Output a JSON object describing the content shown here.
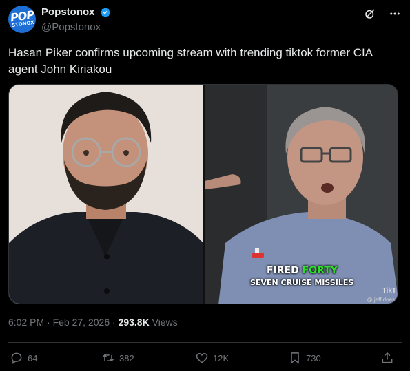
{
  "author": {
    "display_name": "Popstonox",
    "handle": "@Popstonox",
    "avatar_text_top": "POP",
    "avatar_text_bottom": "STONOX",
    "verified_color": "#1d9bf0"
  },
  "tweet": {
    "text": "Hasan Piker confirms upcoming stream with trending tiktok former CIA agent John Kiriakou"
  },
  "media": {
    "caption_line1_prefix": "FIRED ",
    "caption_line1_highlight": "FORTY",
    "caption_line2": "SEVEN CRUISE MISSILES",
    "watermark": "TikT",
    "watermark_user": "@ jeff.does",
    "highlight_color": "#2ee02a"
  },
  "meta": {
    "time": "6:02 PM",
    "separator1": " · ",
    "date": "Feb 27, 2026",
    "separator2": " · ",
    "views_count": "293.8K",
    "views_label": " Views"
  },
  "actions": {
    "replies": "64",
    "reposts": "382",
    "likes": "12K",
    "bookmarks": "730"
  },
  "icons": [
    "verified-icon",
    "grok-icon",
    "more-icon",
    "reply-icon",
    "repost-icon",
    "like-icon",
    "bookmark-icon",
    "share-icon"
  ],
  "colors": {
    "background": "#000000",
    "text": "#e7e9ea",
    "secondary": "#71767b",
    "border": "#2f3336"
  }
}
